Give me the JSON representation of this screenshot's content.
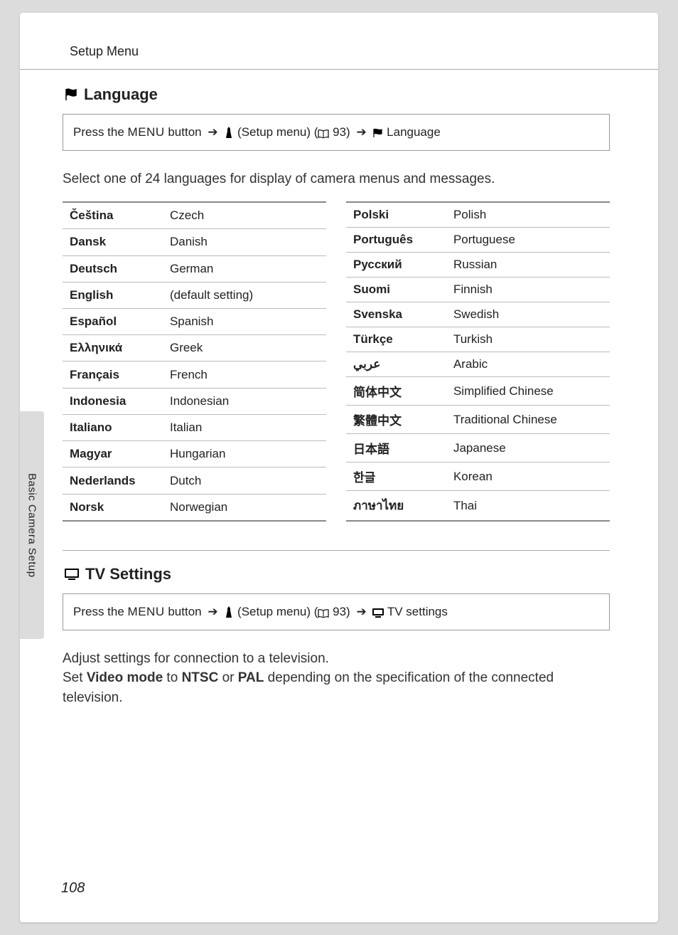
{
  "header": {
    "title": "Setup Menu"
  },
  "side_tab": "Basic Camera Setup",
  "page_number": "108",
  "section_language": {
    "heading": "Language",
    "path_prefix": "Press the ",
    "menu_label": "MENU",
    "button_word": " button ",
    "setup_menu": " (Setup menu) (",
    "ref_page": " 93) ",
    "path_end": " Language",
    "intro": "Select one of 24 languages for display of camera menus and messages."
  },
  "languages_left": [
    {
      "native": "Čeština",
      "english": "Czech"
    },
    {
      "native": "Dansk",
      "english": "Danish"
    },
    {
      "native": "Deutsch",
      "english": "German"
    },
    {
      "native": "English",
      "english": "(default setting)"
    },
    {
      "native": "Español",
      "english": "Spanish"
    },
    {
      "native": "Ελληνικά",
      "english": "Greek"
    },
    {
      "native": "Français",
      "english": "French"
    },
    {
      "native": "Indonesia",
      "english": "Indonesian"
    },
    {
      "native": "Italiano",
      "english": "Italian"
    },
    {
      "native": "Magyar",
      "english": "Hungarian"
    },
    {
      "native": "Nederlands",
      "english": "Dutch"
    },
    {
      "native": "Norsk",
      "english": "Norwegian"
    }
  ],
  "languages_right": [
    {
      "native": "Polski",
      "english": "Polish"
    },
    {
      "native": "Português",
      "english": "Portuguese"
    },
    {
      "native": "Русский",
      "english": "Russian"
    },
    {
      "native": "Suomi",
      "english": "Finnish"
    },
    {
      "native": "Svenska",
      "english": "Swedish"
    },
    {
      "native": "Türkçe",
      "english": "Turkish"
    },
    {
      "native": "عربي",
      "english": "Arabic"
    },
    {
      "native": "简体中文",
      "english": "Simplified Chinese"
    },
    {
      "native": "繁體中文",
      "english": "Traditional Chinese"
    },
    {
      "native": "日本語",
      "english": "Japanese"
    },
    {
      "native": "한글",
      "english": "Korean"
    },
    {
      "native": "ภาษาไทย",
      "english": "Thai"
    }
  ],
  "section_tv": {
    "heading": "TV Settings",
    "path_prefix": "Press the ",
    "menu_label": "MENU",
    "button_word": " button ",
    "setup_menu": " (Setup menu) (",
    "ref_page": " 93) ",
    "path_end": " TV settings",
    "intro_line1": "Adjust settings for connection to a television.",
    "intro_set": "Set ",
    "videomode": "Video mode",
    "intro_to": " to ",
    "ntsc": "NTSC",
    "intro_or": " or ",
    "pal": "PAL",
    "intro_rest": " depending on the specification of the connected television."
  }
}
